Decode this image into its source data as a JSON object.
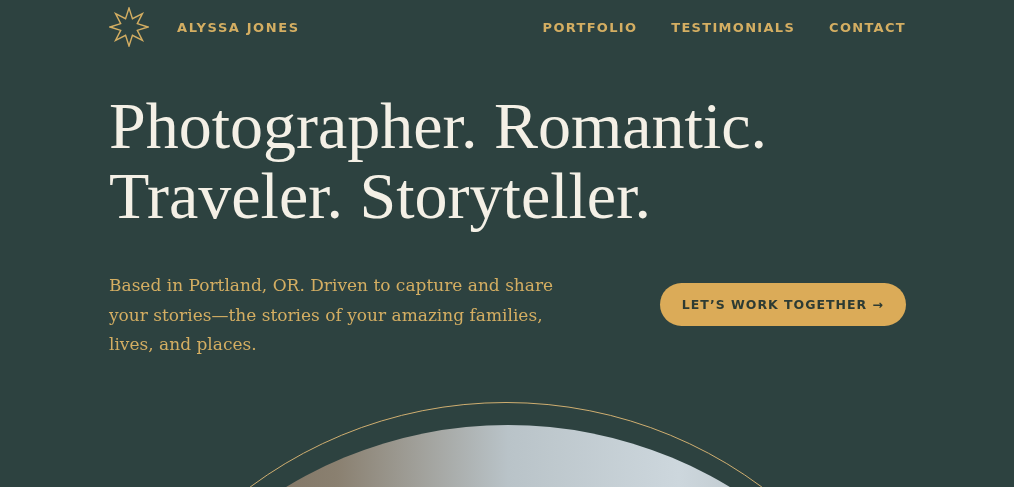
{
  "header": {
    "brand": "ALYSSA JONES",
    "nav": [
      {
        "label": "PORTFOLIO"
      },
      {
        "label": "TESTIMONIALS"
      },
      {
        "label": "CONTACT"
      }
    ]
  },
  "hero": {
    "headline_lines": [
      "Photographer. Romantic.",
      "Traveler. Storyteller."
    ],
    "intro": "Based in Portland, OR. Driven to capture and share your stories—the stories of your amazing families, lives, and places.",
    "cta": "LET’S WORK TOGETHER →"
  }
}
